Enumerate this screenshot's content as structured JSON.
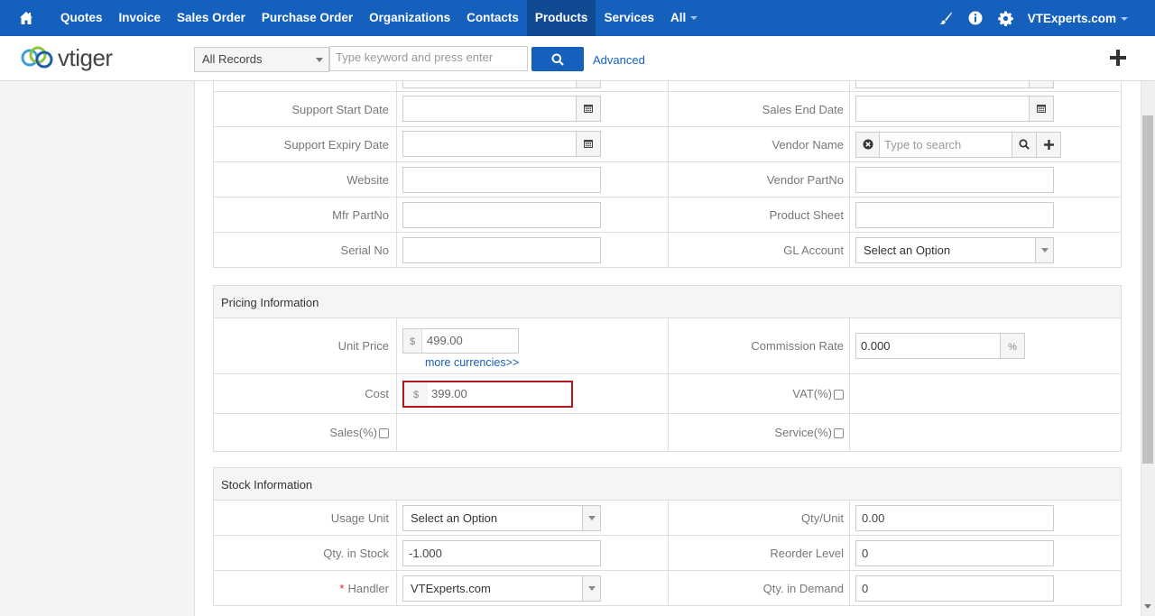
{
  "topnav": {
    "items": [
      "Quotes",
      "Invoice",
      "Sales Order",
      "Purchase Order",
      "Organizations",
      "Contacts",
      "Products",
      "Services",
      "All"
    ],
    "active": "Products",
    "user": "VTExperts.com",
    "bg_color": "#1560bd"
  },
  "subbar": {
    "logo_text": "vtiger",
    "records_filter": "All Records",
    "search_placeholder": "Type keyword and press enter",
    "advanced_label": "Advanced"
  },
  "detail_rows": [
    {
      "left_label": "Support Start Date",
      "left_value": "",
      "right_label": "Sales End Date",
      "right_value": ""
    },
    {
      "left_label": "Support Expiry Date",
      "left_value": "",
      "right_label": "Vendor Name",
      "right_value": ""
    },
    {
      "left_label": "Website",
      "left_value": "",
      "right_label": "Vendor PartNo",
      "right_value": ""
    },
    {
      "left_label": "Mfr PartNo",
      "left_value": "",
      "right_label": "Product Sheet",
      "right_value": ""
    },
    {
      "left_label": "Serial No",
      "left_value": "",
      "right_label": "GL Account",
      "right_value": "Select an Option"
    }
  ],
  "vendor_placeholder": "Type to search",
  "pricing": {
    "title": "Pricing Information",
    "unit_price_label": "Unit Price",
    "currency_symbol": "$",
    "unit_price": "499.00",
    "more_currencies": "more currencies>>",
    "commission_label": "Commission Rate",
    "commission_value": "0.000",
    "percent_symbol": "%",
    "cost_label": "Cost",
    "cost_value": "399.00",
    "vat_label": "VAT(%)",
    "sales_label": "Sales(%)",
    "service_label": "Service(%)",
    "highlight_color": "#b4161b"
  },
  "stock": {
    "title": "Stock Information",
    "usage_unit_label": "Usage Unit",
    "usage_unit_value": "Select an Option",
    "qty_unit_label": "Qty/Unit",
    "qty_unit_value": "0.00",
    "qty_stock_label": "Qty. in Stock",
    "qty_stock_value": "-1.000",
    "reorder_label": "Reorder Level",
    "reorder_value": "0",
    "handler_required": "*",
    "handler_label": "Handler",
    "handler_value": "VTExperts.com",
    "qty_demand_label": "Qty. in Demand",
    "qty_demand_value": "0"
  }
}
